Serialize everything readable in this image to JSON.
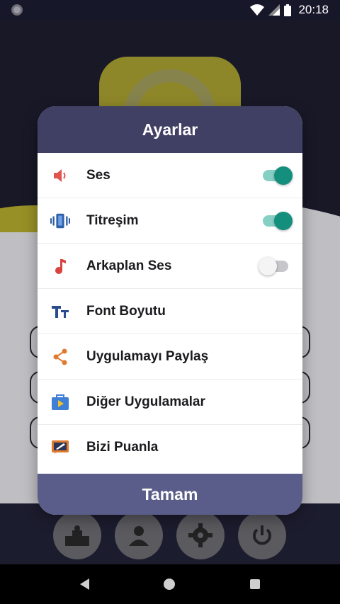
{
  "status_bar": {
    "time": "20:18"
  },
  "dialog": {
    "title": "Ayarlar",
    "items": [
      {
        "label": "Ses",
        "icon": "speaker-icon",
        "toggle": "on"
      },
      {
        "label": "Titreşim",
        "icon": "vibration-icon",
        "toggle": "on"
      },
      {
        "label": "Arkaplan Ses",
        "icon": "music-note-icon",
        "toggle": "off"
      },
      {
        "label": "Font Boyutu",
        "icon": "text-size-icon"
      },
      {
        "label": "Uygulamayı Paylaş",
        "icon": "share-icon"
      },
      {
        "label": "Diğer Uygulamalar",
        "icon": "play-bag-icon"
      },
      {
        "label": "Bizi Puanla",
        "icon": "rate-icon"
      }
    ],
    "ok_label": "Tamam"
  },
  "colors": {
    "header": "#3f4064",
    "footer": "#5a5d8a",
    "toggle_on": "#148f7e",
    "toggle_track_on": "#86cfc4"
  }
}
